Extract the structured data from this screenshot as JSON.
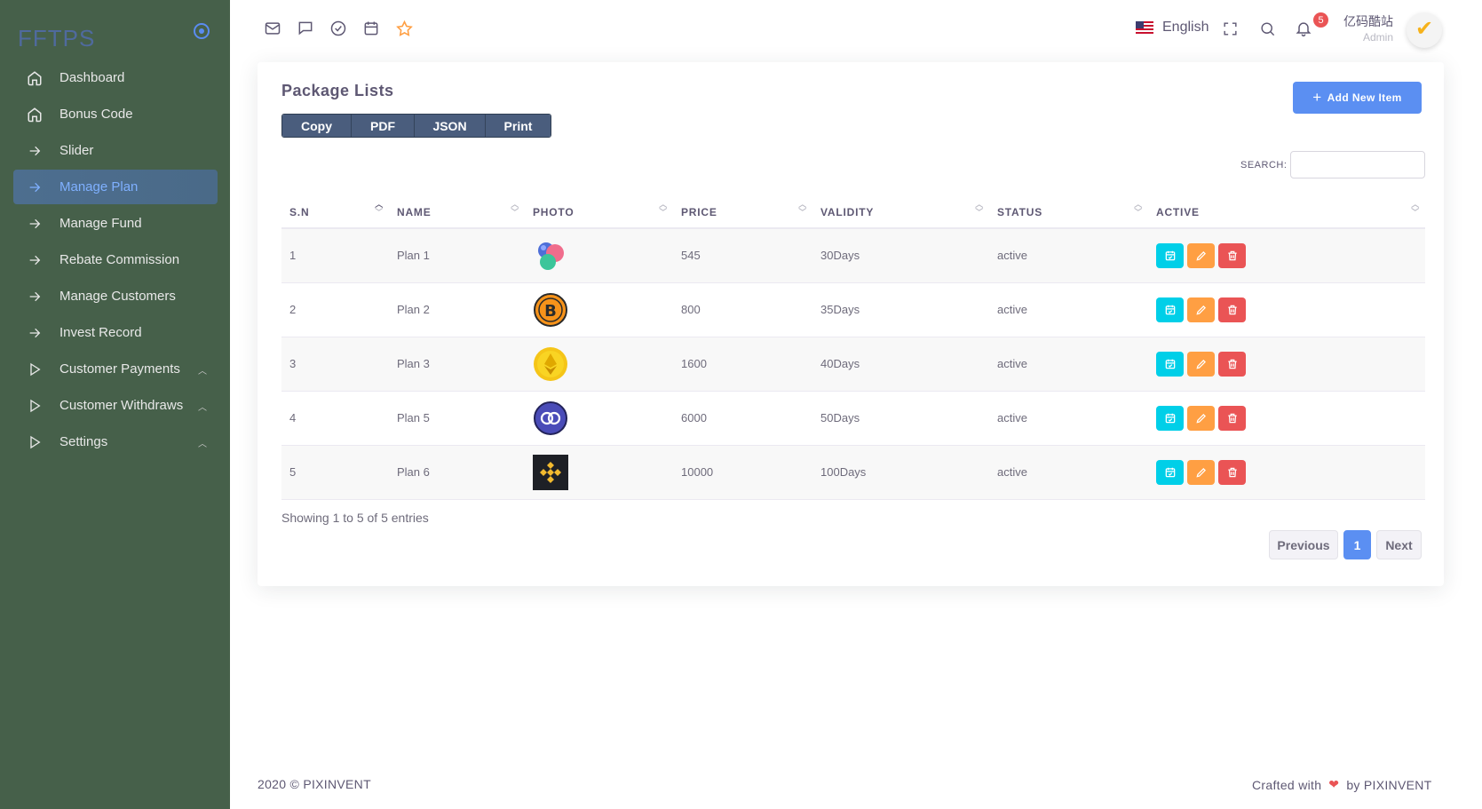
{
  "brand": {
    "name": "FFTPS"
  },
  "sidebar": {
    "items": [
      {
        "label": "Dashboard",
        "icon": "home-icon"
      },
      {
        "label": "Bonus Code",
        "icon": "home-icon"
      },
      {
        "label": "Slider",
        "icon": "arrow-right-icon"
      },
      {
        "label": "Manage Plan",
        "icon": "arrow-right-icon",
        "active": true
      },
      {
        "label": "Manage Fund",
        "icon": "arrow-right-icon"
      },
      {
        "label": "Rebate Commission",
        "icon": "arrow-right-icon"
      },
      {
        "label": "Manage Customers",
        "icon": "arrow-right-icon"
      },
      {
        "label": "Invest Record",
        "icon": "arrow-right-icon"
      },
      {
        "label": "Customer Payments",
        "icon": "play-icon",
        "expandable": true
      },
      {
        "label": "Customer Withdraws",
        "icon": "play-icon",
        "expandable": true
      },
      {
        "label": "Settings",
        "icon": "play-icon",
        "expandable": true
      }
    ]
  },
  "topbar": {
    "language": "English",
    "notifications_count": "5",
    "user_name": "亿码酷站",
    "user_role": "Admin"
  },
  "card": {
    "title": "Package Lists",
    "add_button": "Add New Item",
    "export_buttons": [
      "Copy",
      "PDF",
      "JSON",
      "Print"
    ],
    "search_label": "SEARCH:",
    "search_value": ""
  },
  "table": {
    "headers": [
      "S.N",
      "NAME",
      "PHOTO",
      "PRICE",
      "VALIDITY",
      "STATUS",
      "ACTIVE"
    ],
    "rows": [
      {
        "sn": "1",
        "name": "Plan 1",
        "photo": "gems-icon",
        "price": "545",
        "validity": "30Days",
        "status": "active"
      },
      {
        "sn": "2",
        "name": "Plan 2",
        "photo": "bitcoin-icon",
        "price": "800",
        "validity": "35Days",
        "status": "active"
      },
      {
        "sn": "3",
        "name": "Plan 3",
        "photo": "ethereum-icon",
        "price": "1600",
        "validity": "40Days",
        "status": "active"
      },
      {
        "sn": "4",
        "name": "Plan 5",
        "photo": "polygon-icon",
        "price": "6000",
        "validity": "50Days",
        "status": "active"
      },
      {
        "sn": "5",
        "name": "Plan 6",
        "photo": "binance-icon",
        "price": "10000",
        "validity": "100Days",
        "status": "active"
      }
    ]
  },
  "footer_info": "Showing 1 to 5 of 5 entries",
  "pagination": {
    "previous": "Previous",
    "current": "1",
    "next": "Next"
  },
  "footer": {
    "copyright": "2020 © PIXINVENT",
    "crafted_prefix": "Crafted with",
    "crafted_suffix": "by PIXINVENT"
  },
  "colors": {
    "sidebar": "#46604a",
    "primary": "#5b8ff2",
    "info": "#00cfe8",
    "warning": "#ff9f43",
    "danger": "#ea5455"
  }
}
